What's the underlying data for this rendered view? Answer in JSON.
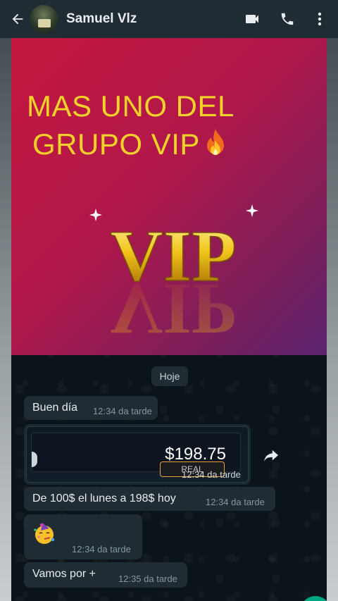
{
  "header": {
    "contact_name": "Samuel Vlz",
    "back_icon": "arrow-left-icon",
    "video_icon": "video-camera-icon",
    "call_icon": "phone-icon",
    "menu_icon": "more-vert-icon",
    "background_color": "#1f2c34"
  },
  "image_message": {
    "title_line1": "MAS UNO DEL",
    "title_line2": "GRUPO VIP",
    "logo_text": "VIP",
    "title_color": "#f2d22a",
    "background_colors": [
      "#c4193f",
      "#5a2470"
    ]
  },
  "date_separator": "Hoje",
  "messages": [
    {
      "text": "Buen día",
      "time": "12:34 da tarde"
    },
    {
      "type": "balance",
      "value": "$198.75",
      "tag": "REAL",
      "time": "12:34 da tarde"
    },
    {
      "text": "De 100$ el lunes a 198$ hoy",
      "time": "12:34 da tarde"
    },
    {
      "type": "emoji",
      "emoji_icon": "partying-face-emoji",
      "time": "12:34 da tarde"
    },
    {
      "text": "Vamos por +",
      "time": "12:35 da tarde"
    }
  ],
  "forward_icon": "forward-icon",
  "colors": {
    "chat_background": "#0b141a",
    "bubble": "#1f2c34",
    "accent": "#00a884"
  }
}
